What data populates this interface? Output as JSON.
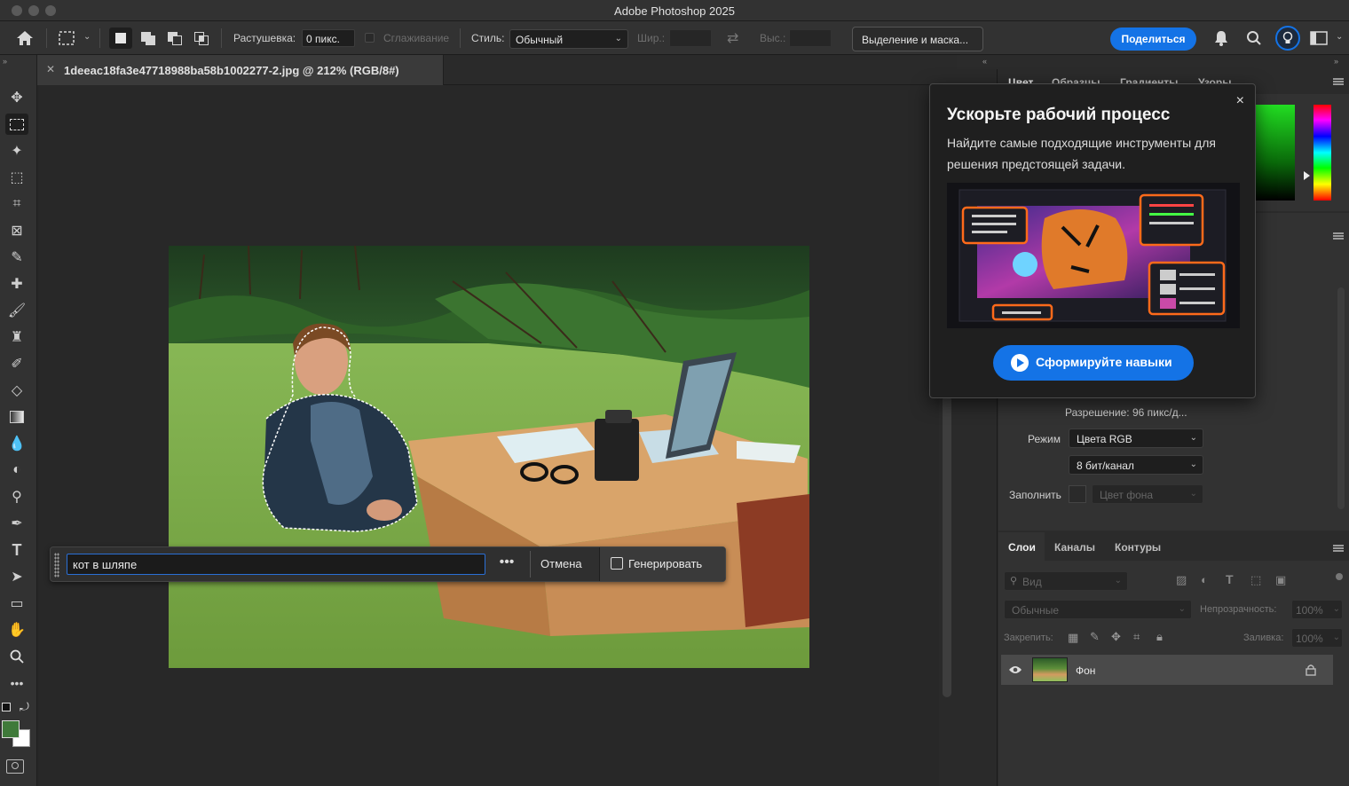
{
  "app": {
    "title": "Adobe Photoshop 2025"
  },
  "options_bar": {
    "feather_label": "Растушевка:",
    "feather_value": "0 пикс.",
    "antialias_label": "Сглаживание",
    "style_label": "Стиль:",
    "style_value": "Обычный",
    "width_label": "Шир.:",
    "height_label": "Выс.:",
    "select_mask_button": "Выделение и маска...",
    "share_button": "Поделиться"
  },
  "document": {
    "tab_title": "1deeac18fa3e47718988ba58b1002277-2.jpg @ 212% (RGB/8#)"
  },
  "taskbar": {
    "prompt_value": "кот в шляпе",
    "more": "•••",
    "cancel": "Отмена",
    "generate": "Генерировать"
  },
  "popover": {
    "title": "Ускорьте рабочий процесс",
    "description": "Найдите самые подходящие инструменты для решения предстоящей задачи.",
    "cta": "Сформируйте навыки",
    "close": "×"
  },
  "color_panel": {
    "tabs": [
      "Цвет",
      "Образцы",
      "Градиенты",
      "Узоры"
    ]
  },
  "properties": {
    "resolution": "Разрешение: 96 пикс/д...",
    "mode_label": "Режим",
    "mode_value": "Цвета RGB",
    "depth_value": "8 бит/канал",
    "fill_label": "Заполнить",
    "fill_value": "Цвет фона"
  },
  "layers_panel": {
    "tabs": [
      "Слои",
      "Каналы",
      "Контуры"
    ],
    "search_placeholder": "Вид",
    "blend_mode": "Обычные",
    "opacity_label": "Непрозрачность:",
    "opacity_value": "100%",
    "lock_label": "Закрепить:",
    "fill_label": "Заливка:",
    "fill_value": "100%",
    "layer_name": "Фон"
  },
  "colors": {
    "accent": "#1473e6",
    "foreground": "#3f7a3a",
    "background": "#ffffff"
  }
}
